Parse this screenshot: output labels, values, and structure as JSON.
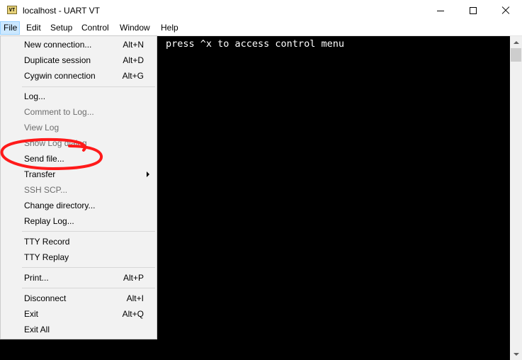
{
  "window": {
    "icon_text": "VT",
    "title": "localhost - UART VT"
  },
  "menubar": {
    "items": [
      "File",
      "Edit",
      "Setup",
      "Control",
      "Window",
      "Help"
    ],
    "active": "File"
  },
  "terminal": {
    "text": "press ^x to access control menu"
  },
  "file_menu": {
    "items": [
      {
        "label": "New connection...",
        "accel": "Alt+N",
        "enabled": true
      },
      {
        "label": "Duplicate session",
        "accel": "Alt+D",
        "enabled": true
      },
      {
        "label": "Cygwin connection",
        "accel": "Alt+G",
        "enabled": true
      },
      {
        "label": "Log...",
        "accel": "",
        "enabled": true
      },
      {
        "label": "Comment to Log...",
        "accel": "",
        "enabled": false
      },
      {
        "label": "View Log",
        "accel": "",
        "enabled": false
      },
      {
        "label": "Show Log dialog",
        "accel": "",
        "enabled": false
      },
      {
        "label": "Send file...",
        "accel": "",
        "enabled": true
      },
      {
        "label": "Transfer",
        "accel": "",
        "enabled": true,
        "submenu": true
      },
      {
        "label": "SSH SCP...",
        "accel": "",
        "enabled": false
      },
      {
        "label": "Change directory...",
        "accel": "",
        "enabled": true
      },
      {
        "label": "Replay Log...",
        "accel": "",
        "enabled": true
      },
      {
        "label": "TTY Record",
        "accel": "",
        "enabled": true
      },
      {
        "label": "TTY Replay",
        "accel": "",
        "enabled": true
      },
      {
        "label": "Print...",
        "accel": "Alt+P",
        "enabled": true
      },
      {
        "label": "Disconnect",
        "accel": "Alt+I",
        "enabled": true
      },
      {
        "label": "Exit",
        "accel": "Alt+Q",
        "enabled": true
      },
      {
        "label": "Exit All",
        "accel": "",
        "enabled": true
      }
    ]
  },
  "colors": {
    "annotation": "#ff0000",
    "terminal_bg": "#000000",
    "terminal_fg": "#ffffff",
    "menu_bg": "#f2f2f2",
    "active_menu_bg": "#cce8ff"
  }
}
